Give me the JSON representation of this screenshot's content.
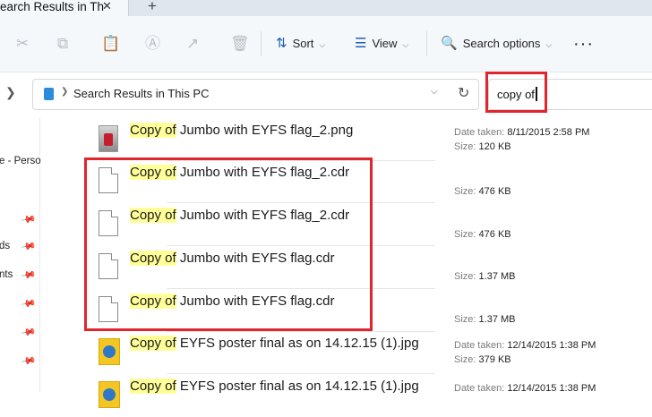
{
  "window": {
    "tab_title": "earch Results in Th",
    "tab_close": "✕",
    "new_tab": "+"
  },
  "toolbar": {
    "sort_label": "Sort",
    "view_label": "View",
    "search_options_label": "Search options",
    "more_label": "···"
  },
  "address": {
    "path": "Search Results in This PC",
    "search_query": "copy of"
  },
  "nav_pane": {
    "items": [
      "e - Perso",
      "ds",
      "nts"
    ]
  },
  "results": [
    {
      "match": "Copy of",
      "rest": " Jumbo with EYFS flag_2.png",
      "icon": "png-image-icon",
      "date_label": "Date taken:",
      "date": "8/11/2015 2:58 PM",
      "size_label": "Size:",
      "size": "120 KB"
    },
    {
      "match": "Copy of",
      "rest": " Jumbo with EYFS flag_2.cdr",
      "icon": "document-icon",
      "size_label": "Size:",
      "size": "476 KB"
    },
    {
      "match": "Copy of",
      "rest": " Jumbo with EYFS flag_2.cdr",
      "icon": "document-icon",
      "size_label": "Size:",
      "size": "476 KB"
    },
    {
      "match": "Copy of",
      "rest": " Jumbo with EYFS flag.cdr",
      "icon": "document-icon",
      "size_label": "Size:",
      "size": "1.37 MB"
    },
    {
      "match": "Copy of",
      "rest": " Jumbo with EYFS flag.cdr",
      "icon": "document-icon",
      "size_label": "Size:",
      "size": "1.37 MB"
    },
    {
      "match": "Copy of",
      "rest": " EYFS poster final as on 14.12.15 (1).jpg",
      "icon": "jpg-image-icon",
      "date_label": "Date taken:",
      "date": "12/14/2015 1:38 PM",
      "size_label": "Size:",
      "size": "379 KB"
    },
    {
      "match": "Copy of",
      "rest": " EYFS poster final as on 14.12.15 (1).jpg",
      "icon": "jpg-image-icon",
      "date_label": "Date taken:",
      "date": "12/14/2015 1:38 PM"
    }
  ],
  "colors": {
    "highlight": "#ffff99",
    "annotation": "#e0252d",
    "accent": "#1e5fb3"
  }
}
